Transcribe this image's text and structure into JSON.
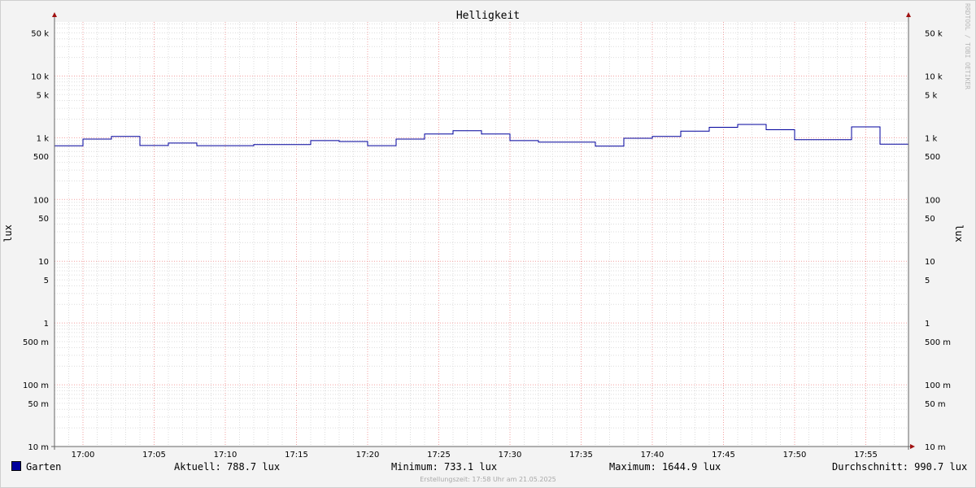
{
  "chart_data": {
    "type": "line",
    "title": "Helligkeit",
    "ylabel": "lux",
    "y_scale": "log",
    "ylim": [
      0.01,
      75000
    ],
    "x_range": [
      "16:58",
      "17:58"
    ],
    "x_ticks": [
      "17:00",
      "17:05",
      "17:10",
      "17:15",
      "17:20",
      "17:25",
      "17:30",
      "17:35",
      "17:40",
      "17:45",
      "17:50",
      "17:55"
    ],
    "y_ticks": [
      "10 m",
      "50 m",
      "100 m",
      "500 m",
      "1",
      "5",
      "10",
      "50",
      "100",
      "500",
      "1 k",
      "5 k",
      "10 k",
      "50 k"
    ],
    "grid": true,
    "series": [
      {
        "name": "Garten",
        "color": "#00009c",
        "step": true,
        "points": [
          [
            "16:58",
            740
          ],
          [
            "17:00",
            950
          ],
          [
            "17:02",
            1050
          ],
          [
            "17:04",
            750
          ],
          [
            "17:06",
            820
          ],
          [
            "17:08",
            745
          ],
          [
            "17:12",
            775
          ],
          [
            "17:16",
            900
          ],
          [
            "17:18",
            870
          ],
          [
            "17:20",
            745
          ],
          [
            "17:22",
            950
          ],
          [
            "17:24",
            1150
          ],
          [
            "17:26",
            1300
          ],
          [
            "17:28",
            1150
          ],
          [
            "17:30",
            900
          ],
          [
            "17:32",
            850
          ],
          [
            "17:36",
            733.1
          ],
          [
            "17:38",
            980
          ],
          [
            "17:40",
            1050
          ],
          [
            "17:42",
            1280
          ],
          [
            "17:44",
            1480
          ],
          [
            "17:46",
            1644.9
          ],
          [
            "17:48",
            1350
          ],
          [
            "17:50",
            930
          ],
          [
            "17:54",
            1500
          ],
          [
            "17:56",
            788.7
          ],
          [
            "17:58",
            788.7
          ]
        ]
      }
    ]
  },
  "legend": {
    "series_name": "Garten",
    "current": "Aktuell: 788.7 lux",
    "minimum": "Minimum: 733.1 lux",
    "maximum": "Maximum: 1644.9 lux",
    "average": "Durchschnitt: 990.7 lux"
  },
  "watermark": "RRDTOOL / TOBI OETIKER",
  "footer": "Erstellungszeit: 17:58 Uhr am 21.05.2025"
}
